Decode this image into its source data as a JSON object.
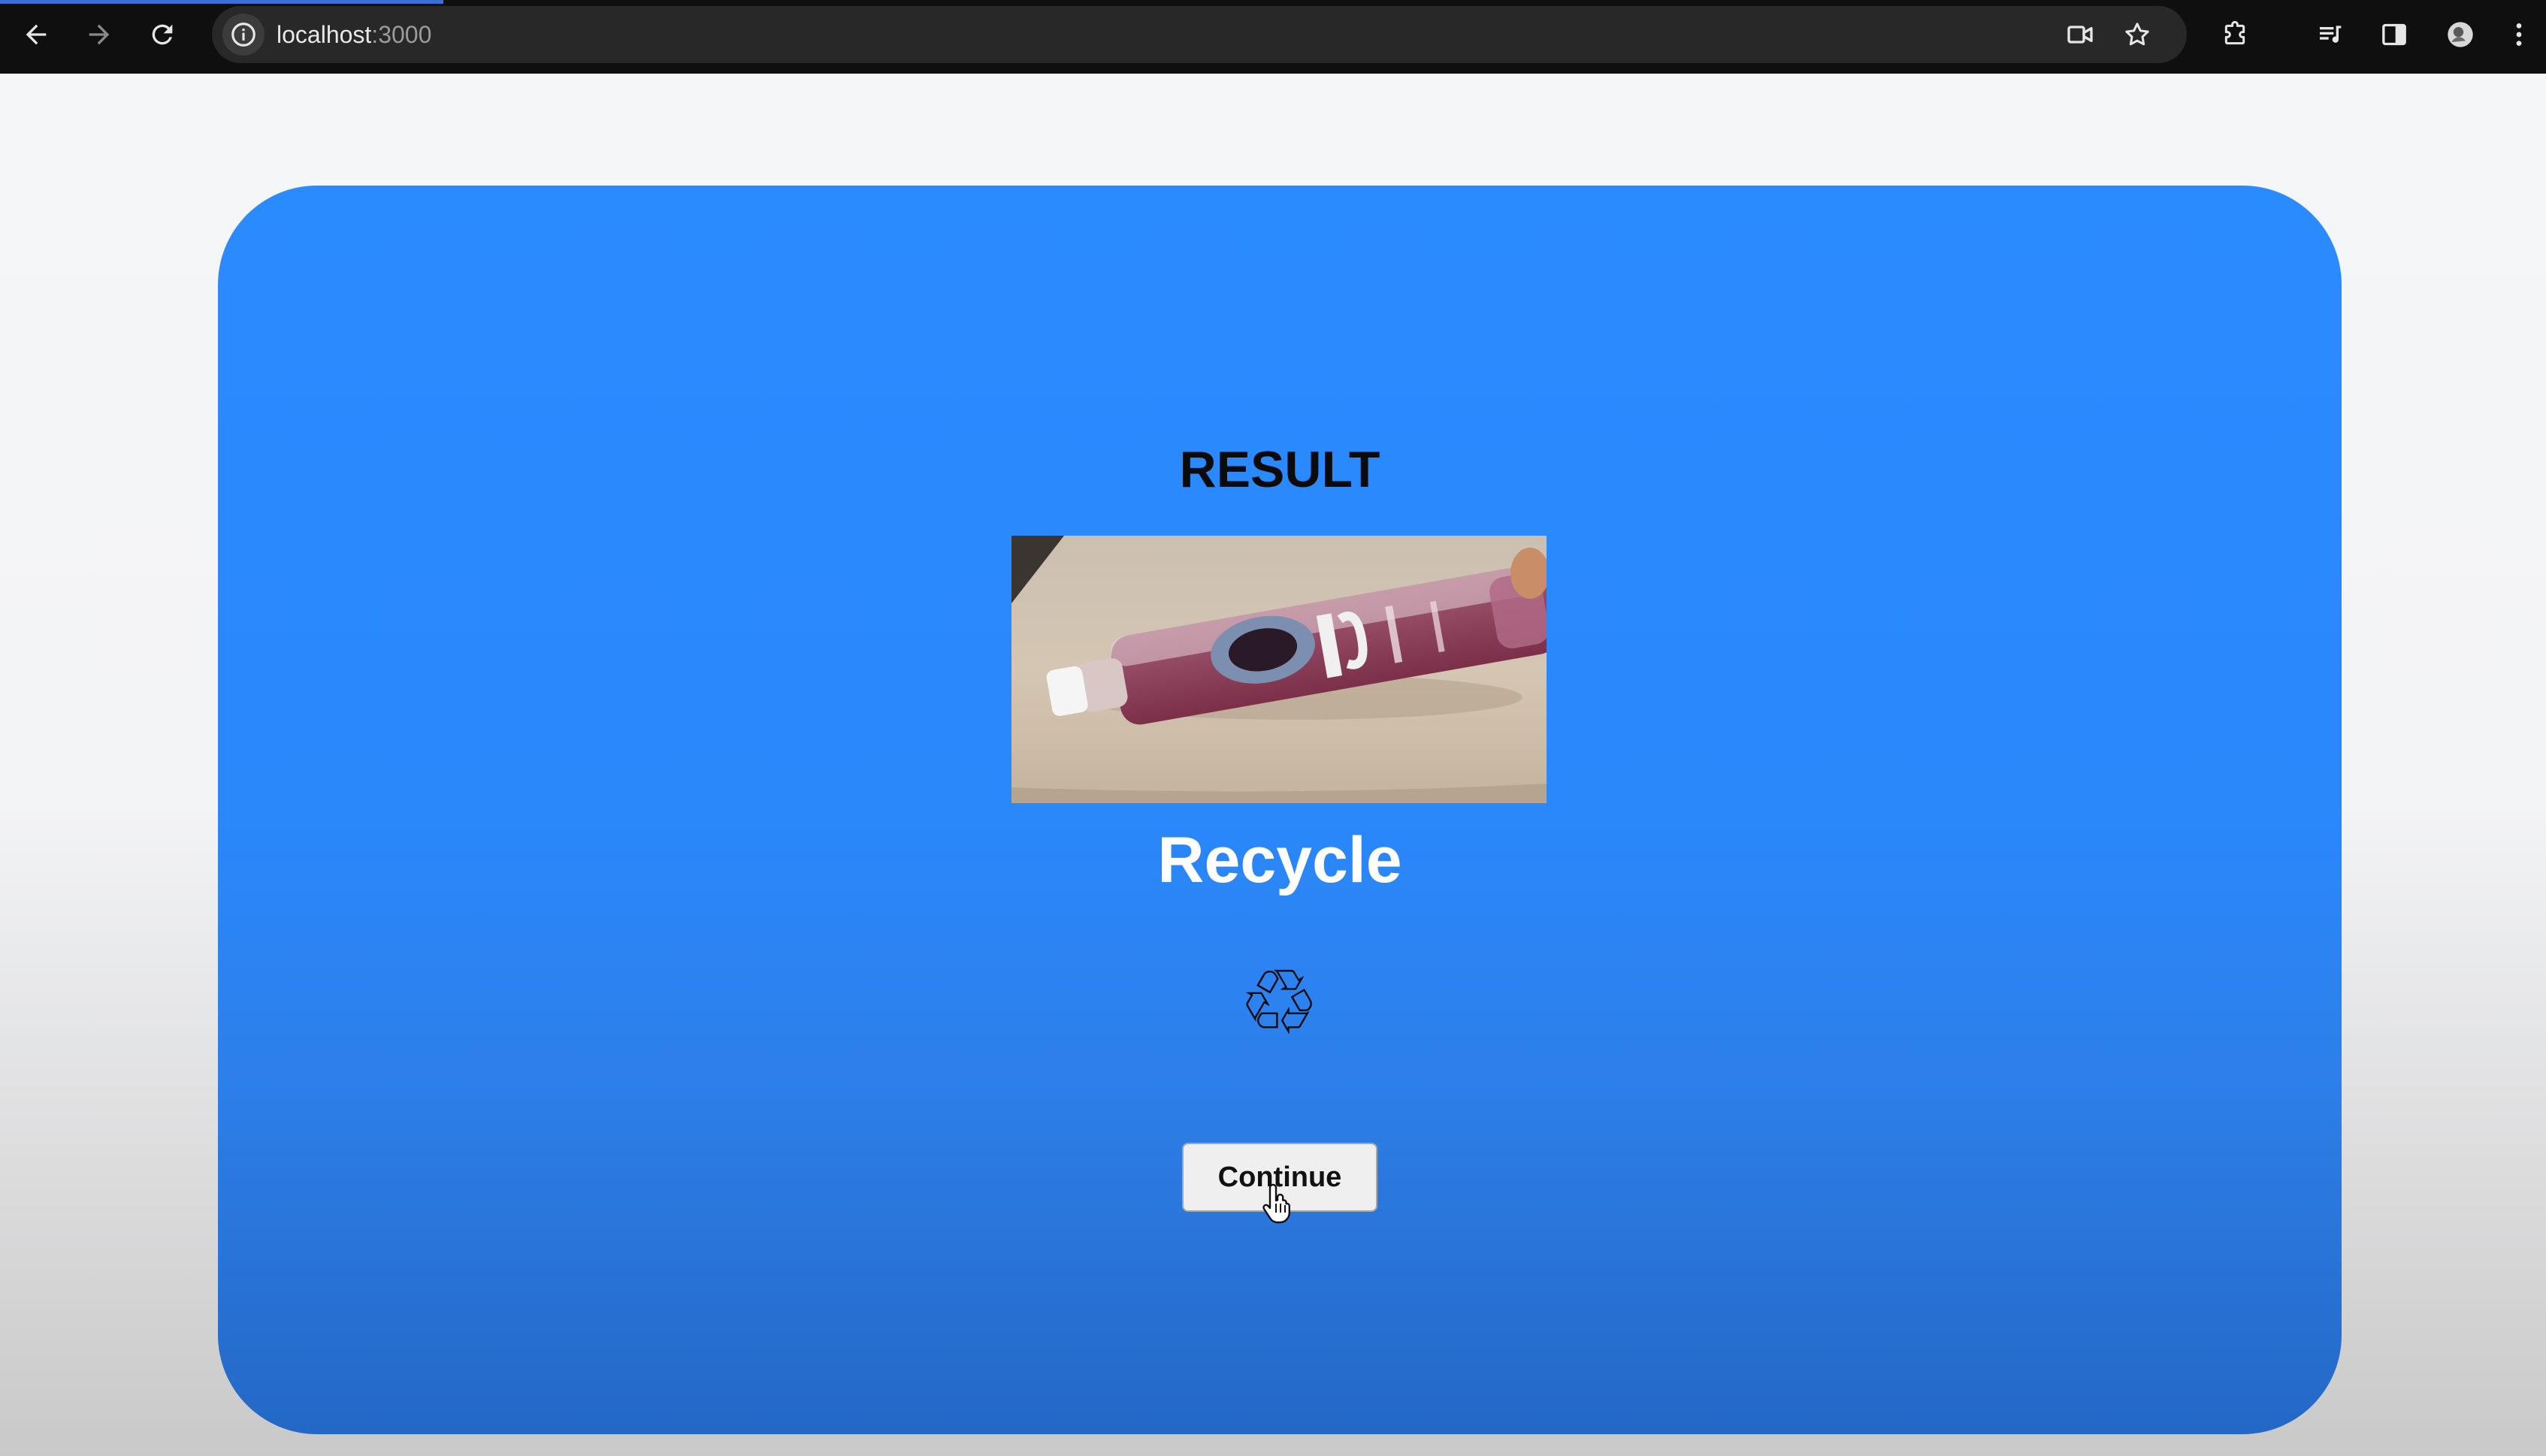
{
  "browser": {
    "url_host": "localhost",
    "url_port": ":3000",
    "icons": {
      "back": "arrow-left-icon",
      "forward": "arrow-right-icon",
      "reload": "reload-icon",
      "site_info": "info-icon",
      "camera": "video-camera-icon",
      "bookmark": "star-icon",
      "extensions": "puzzle-icon",
      "media": "media-queue-icon",
      "side_panel": "side-panel-icon",
      "profile": "avatar-icon",
      "menu": "kebab-menu-icon"
    }
  },
  "page": {
    "title": "RESULT",
    "classification": "Recycle",
    "classification_icon": "♲",
    "continue_label": "Continue",
    "colors": {
      "card_top": "#2a8aff",
      "card_bottom": "#2468c6",
      "title_text": "#0b0b0b",
      "classification_text": "#ffffff"
    }
  }
}
